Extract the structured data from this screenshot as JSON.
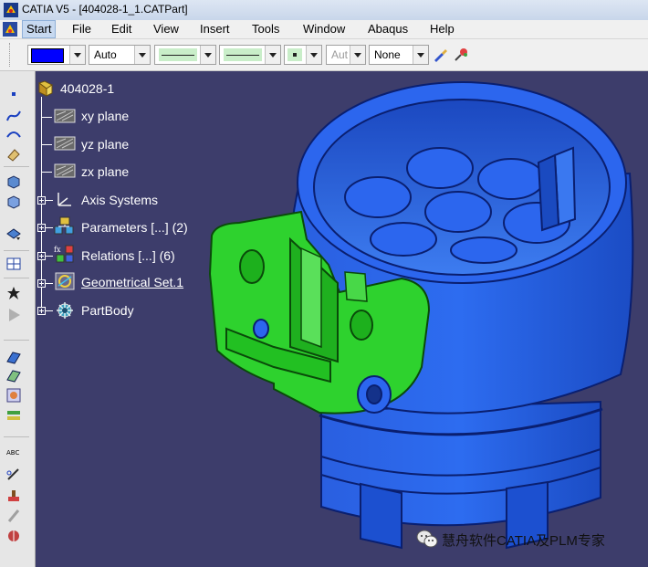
{
  "window": {
    "title": "CATIA V5 - [404028-1_1.CATPart]",
    "app_icon": "catia-logo-icon"
  },
  "menubar": {
    "items": [
      {
        "label": "Start",
        "active": true
      },
      {
        "label": "File"
      },
      {
        "label": "Edit"
      },
      {
        "label": "View"
      },
      {
        "label": "Insert"
      },
      {
        "label": "Tools"
      },
      {
        "label": "Window"
      },
      {
        "label": "Abaqus"
      },
      {
        "label": "Help"
      }
    ]
  },
  "properties_toolbar": {
    "color_swatch": "#0000ff",
    "transparency": "Auto",
    "line_thickness": "",
    "line_type": "",
    "point_symbol": "",
    "layer_auto": "Aut",
    "layer": "None",
    "icons": [
      "painter-icon",
      "format-painter-icon"
    ]
  },
  "left_toolbar": {
    "icons": [
      "point-icon",
      "spline-icon",
      "arc-icon",
      "eraser-icon",
      "cube-icon",
      "cube-plus-icon",
      "part-design-icon",
      "grid-icon",
      "star-icon",
      "play-icon",
      "surface-icon",
      "wireframe-icon",
      "texture-icon",
      "layers-icon",
      "abc-icon",
      "pen-icon",
      "stamp-icon",
      "measure-icon",
      "tool-icon"
    ]
  },
  "tree": {
    "root": "404028-1",
    "nodes": [
      {
        "label": "xy plane",
        "icon": "plane-icon"
      },
      {
        "label": "yz plane",
        "icon": "plane-icon"
      },
      {
        "label": "zx plane",
        "icon": "plane-icon"
      },
      {
        "label": "Axis Systems",
        "icon": "axis-system-icon",
        "expandable": true
      },
      {
        "label": "Parameters [...] (2)",
        "icon": "parameters-icon",
        "expandable": true
      },
      {
        "label": "Relations [...] (6)",
        "icon": "relations-icon",
        "expandable": true
      },
      {
        "label": "Geometrical Set.1",
        "icon": "geometrical-set-icon",
        "expandable": true,
        "underlined": true
      },
      {
        "label": "PartBody",
        "icon": "partbody-icon",
        "expandable": true
      }
    ]
  },
  "viewport": {
    "background": "#3d3d6b",
    "part_color": "#1f5fe0",
    "bracket_color": "#2ad22a"
  },
  "watermark": {
    "text": "慧舟软件CATIA及PLM专家",
    "icon": "wechat-icon"
  }
}
